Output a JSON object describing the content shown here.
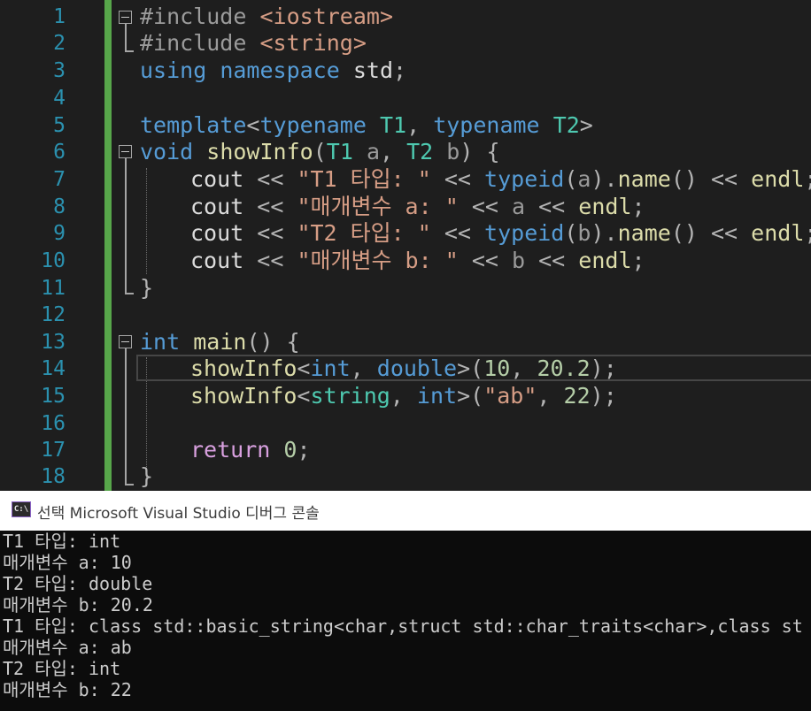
{
  "editor": {
    "line_numbers": [
      "1",
      "2",
      "3",
      "4",
      "5",
      "6",
      "7",
      "8",
      "9",
      "10",
      "11",
      "12",
      "13",
      "14",
      "15",
      "16",
      "17",
      "18"
    ],
    "code": {
      "l1": {
        "kw": "#include",
        "arg": "<iostream>"
      },
      "l2": {
        "kw": "#include",
        "arg": "<string>"
      },
      "l3": {
        "using": "using",
        "namespace": "namespace",
        "std": "std",
        "semi": ";"
      },
      "l5": {
        "template": "template",
        "lt": "<",
        "typename1": "typename",
        "t1": "T1",
        "comma": ",",
        "typename2": "typename",
        "t2": "T2",
        "gt": ">"
      },
      "l6": {
        "void": "void",
        "fn": "showInfo",
        "open": "(",
        "t1": "T1",
        "a": "a",
        "comma": ",",
        "t2": "T2",
        "b": "b",
        "close": ")",
        "brace": "{"
      },
      "l7": {
        "cout": "cout",
        "op1": "<<",
        "str": "\"T1 타입: \"",
        "op2": "<<",
        "typeid": "typeid",
        "p1": "(",
        "arg": "a",
        "p2": ")",
        "dot": ".",
        "name": "name",
        "call": "()",
        "op3": "<<",
        "endl": "endl",
        "semi": ";"
      },
      "l8": {
        "cout": "cout",
        "op1": "<<",
        "str": "\"매개변수 a: \"",
        "op2": "<<",
        "var": "a",
        "op3": "<<",
        "endl": "endl",
        "semi": ";"
      },
      "l9": {
        "cout": "cout",
        "op1": "<<",
        "str": "\"T2 타입: \"",
        "op2": "<<",
        "typeid": "typeid",
        "p1": "(",
        "arg": "b",
        "p2": ")",
        "dot": ".",
        "name": "name",
        "call": "()",
        "op3": "<<",
        "endl": "endl",
        "semi": ";"
      },
      "l10": {
        "cout": "cout",
        "op1": "<<",
        "str": "\"매개변수 b: \"",
        "op2": "<<",
        "var": "b",
        "op3": "<<",
        "endl": "endl",
        "semi": ";"
      },
      "l11": {
        "brace": "}"
      },
      "l13": {
        "int": "int",
        "main": "main",
        "parens": "()",
        "brace": "{"
      },
      "l14": {
        "fn": "showInfo",
        "lt": "<",
        "t1": "int",
        "comma": ",",
        "t2": "double",
        "gt": ">",
        "open": "(",
        "n1": "10",
        "comma2": ",",
        "n2": "20.2",
        "close": ")",
        "semi": ";"
      },
      "l15": {
        "fn": "showInfo",
        "lt": "<",
        "t1": "string",
        "comma": ",",
        "t2": "int",
        "gt": ">",
        "open": "(",
        "s": "\"ab\"",
        "comma2": ",",
        "n": "22",
        "close": ")",
        "semi": ";"
      },
      "l17": {
        "ret": "return",
        "n": "0",
        "semi": ";"
      },
      "l18": {
        "brace": "}"
      }
    }
  },
  "console": {
    "icon_label": "C:\\",
    "title": "선택 Microsoft Visual Studio 디버그 콘솔",
    "lines": [
      "T1 타입: int",
      "매개변수 a: 10",
      "T2 타입: double",
      "매개변수 b: 20.2",
      "T1 타입: class std::basic_string<char,struct std::char_traits<char>,class st",
      "매개변수 a: ab",
      "T2 타입: int",
      "매개변수 b: 22"
    ]
  },
  "colors": {
    "background": "#1e1e1e",
    "line_number": "#2b91af",
    "keyword": "#569cd6",
    "type": "#4ec9b0",
    "function": "#dcdcaa",
    "string": "#d69d85",
    "number": "#b5cea8",
    "control": "#d8a0df",
    "change_bar": "#57a64a"
  }
}
